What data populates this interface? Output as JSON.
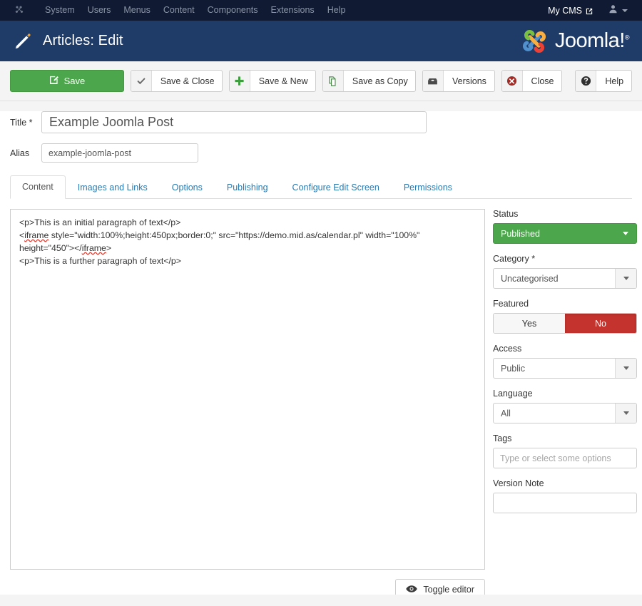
{
  "admin_bar": {
    "brand_icon": "joomla-brand-icon",
    "menu_items": [
      {
        "label": "System"
      },
      {
        "label": "Users"
      },
      {
        "label": "Menus"
      },
      {
        "label": "Content"
      },
      {
        "label": "Components"
      },
      {
        "label": "Extensions"
      },
      {
        "label": "Help"
      }
    ],
    "site_link": "My CMS",
    "site_link_icon": "external-link-icon",
    "user_icon": "user-icon",
    "user_caret_icon": "chevron-down-icon"
  },
  "page_header": {
    "icon": "pencil-icon",
    "title": "Articles: Edit",
    "logo_text": "Joomla!",
    "logo_trademark": "®"
  },
  "toolbar": {
    "save_label": "Save",
    "save_icon": "save-edit-icon",
    "buttons": [
      {
        "label": "Save & Close",
        "icon": "check-icon"
      },
      {
        "label": "Save & New",
        "icon": "plus-icon"
      },
      {
        "label": "Save as Copy",
        "icon": "copy-icon"
      },
      {
        "label": "Versions",
        "icon": "archive-icon"
      },
      {
        "label": "Close",
        "icon": "close-circle-icon"
      }
    ],
    "help_label": "Help",
    "help_icon": "question-circle-icon"
  },
  "form": {
    "title_label": "Title",
    "title_required_mark": "*",
    "title_value": "Example Joomla Post",
    "title_placeholder": "",
    "alias_label": "Alias",
    "alias_value": "example-joomla-post",
    "alias_placeholder": ""
  },
  "tabs": [
    {
      "label": "Content",
      "active": true
    },
    {
      "label": "Images and Links",
      "active": false
    },
    {
      "label": "Options",
      "active": false
    },
    {
      "label": "Publishing",
      "active": false
    },
    {
      "label": "Configure Edit Screen",
      "active": false
    },
    {
      "label": "Permissions",
      "active": false
    }
  ],
  "editor": {
    "line1": "<p>This is an initial paragraph of text</p>",
    "line2_a": "<",
    "line2_misspelled": "iframe",
    "line2_b": " style=\"width:100%;height:450px;border:0;\" src=\"https://demo.mid.as/calendar.pl\" width=\"100%\" height=\"450\"></",
    "line2_misspelled2": "iframe",
    "line2_c": ">",
    "line3": "<p>This is a further paragraph of text</p>",
    "toggle_label": "Toggle editor",
    "toggle_icon": "eye-icon",
    "resize_icon": "resize-grip-icon"
  },
  "sidebar": {
    "status_label": "Status",
    "status_value": "Published",
    "status_color": "#4ca64c",
    "category_label": "Category",
    "category_required_mark": "*",
    "category_value": "Uncategorised",
    "featured_label": "Featured",
    "featured_yes": "Yes",
    "featured_no": "No",
    "featured_selected": "No",
    "featured_active_color": "#c4332e",
    "access_label": "Access",
    "access_value": "Public",
    "language_label": "Language",
    "language_value": "All",
    "tags_label": "Tags",
    "tags_value": "",
    "tags_placeholder": "Type or select some options",
    "version_note_label": "Version Note",
    "version_note_value": "",
    "version_note_placeholder": ""
  }
}
